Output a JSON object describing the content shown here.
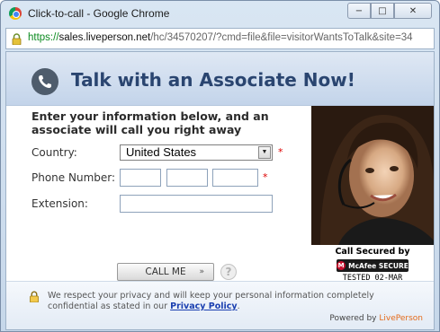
{
  "window": {
    "title": "Click-to-call - Google Chrome",
    "buttons": {
      "minimize": "−",
      "maximize": "□",
      "close": "✕"
    }
  },
  "address": {
    "scheme": "https://",
    "host": "sales.liveperson.net",
    "path": "/hc/34570207/?cmd=file&file=visitorWantsToTalk&site=34"
  },
  "header": {
    "title": "Talk with an Associate Now!"
  },
  "form": {
    "intro": "Enter your information below, and an associate will call you right away",
    "country_label": "Country:",
    "country_value": "United States",
    "phone_label": "Phone Number:",
    "extension_label": "Extension:",
    "required_mark": "*",
    "call_button": "CALL ME",
    "call_chevron": "»",
    "help": "?"
  },
  "security": {
    "label": "Call Secured by",
    "badge_mark": "M",
    "badge_text": "McAfee SECURE",
    "tested": "TESTED  02-MAR"
  },
  "footer": {
    "privacy_text": "We respect your privacy and will keep your personal information completely confidential as stated in our ",
    "privacy_link": "Privacy Policy",
    "privacy_end": ".",
    "powered_by": "Powered by ",
    "powered_brand": "LivePerson"
  },
  "colors": {
    "header_title": "#2a4570",
    "link": "#1a3fb0",
    "required": "#dd0000",
    "brand": "#e46b1b"
  },
  "icons": [
    "chrome-icon",
    "lock-icon",
    "phone-icon",
    "chevron-down-icon",
    "help-icon",
    "padlock-icon",
    "mcafee-icon"
  ]
}
